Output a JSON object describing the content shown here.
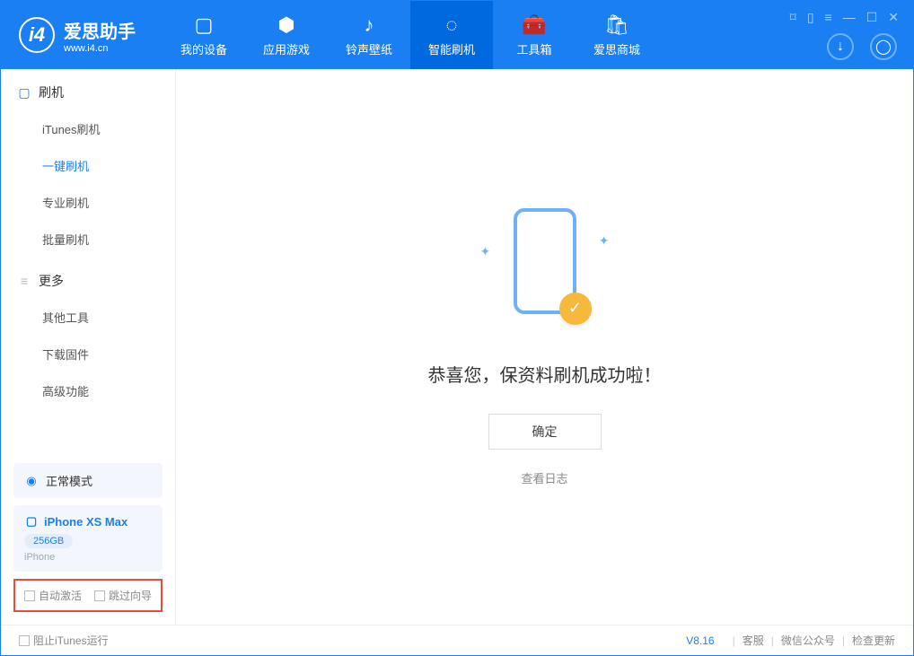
{
  "app": {
    "title": "爱思助手",
    "subtitle": "www.i4.cn"
  },
  "header": {
    "tabs": [
      {
        "label": "我的设备"
      },
      {
        "label": "应用游戏"
      },
      {
        "label": "铃声壁纸"
      },
      {
        "label": "智能刷机"
      },
      {
        "label": "工具箱"
      },
      {
        "label": "爱思商城"
      }
    ]
  },
  "sidebar": {
    "section1_title": "刷机",
    "items1": [
      {
        "label": "iTunes刷机"
      },
      {
        "label": "一键刷机"
      },
      {
        "label": "专业刷机"
      },
      {
        "label": "批量刷机"
      }
    ],
    "section2_title": "更多",
    "items2": [
      {
        "label": "其他工具"
      },
      {
        "label": "下载固件"
      },
      {
        "label": "高级功能"
      }
    ],
    "mode_label": "正常模式",
    "device": {
      "name": "iPhone XS Max",
      "capacity": "256GB",
      "type": "iPhone"
    },
    "opts": {
      "auto_activate": "自动激活",
      "skip_guide": "跳过向导"
    }
  },
  "main": {
    "success_msg": "恭喜您，保资料刷机成功啦！",
    "ok_button": "确定",
    "log_link": "查看日志"
  },
  "footer": {
    "block_itunes": "阻止iTunes运行",
    "version": "V8.16",
    "links": {
      "service": "客服",
      "wechat": "微信公众号",
      "update": "检查更新"
    }
  }
}
